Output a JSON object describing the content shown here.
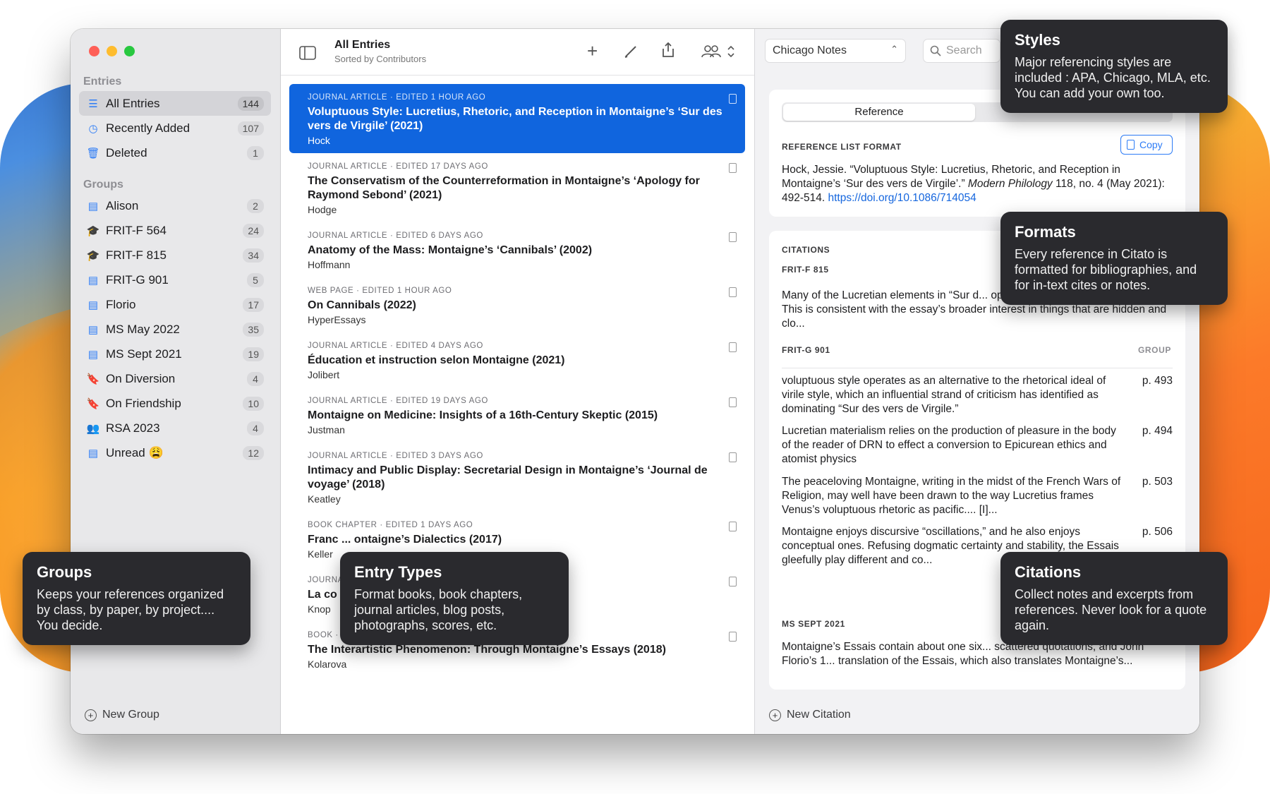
{
  "sidebar": {
    "entries_header": "Entries",
    "entries": [
      {
        "label": "All Entries",
        "count": "144",
        "icon": "list-icon"
      },
      {
        "label": "Recently Added",
        "count": "107",
        "icon": "clock-icon"
      },
      {
        "label": "Deleted",
        "count": "1",
        "icon": "trash-icon"
      }
    ],
    "groups_header": "Groups",
    "groups": [
      {
        "label": "Alison",
        "count": "2",
        "icon": "doc-icon"
      },
      {
        "label": "FRIT-F 564",
        "count": "24",
        "icon": "graduation-cap-icon"
      },
      {
        "label": "FRIT-F 815",
        "count": "34",
        "icon": "graduation-cap-icon"
      },
      {
        "label": "FRIT-G 901",
        "count": "5",
        "icon": "doc-icon"
      },
      {
        "label": "Florio",
        "count": "17",
        "icon": "doc-icon"
      },
      {
        "label": "MS May 2022",
        "count": "35",
        "icon": "doc-icon"
      },
      {
        "label": "MS Sept 2021",
        "count": "19",
        "icon": "doc-icon"
      },
      {
        "label": "On Diversion",
        "count": "4",
        "icon": "bookmark-icon"
      },
      {
        "label": "On Friendship",
        "count": "10",
        "icon": "bookmark-icon"
      },
      {
        "label": "RSA 2023",
        "count": "4",
        "icon": "speaker-icon"
      },
      {
        "label": "Unread 😩",
        "count": "12",
        "icon": "doc-icon"
      }
    ],
    "new_group": "New Group"
  },
  "toolbar": {
    "title": "All Entries",
    "subtitle": "Sorted by Contributors"
  },
  "entries": [
    {
      "meta": "Journal Article · Edited 1 hour ago",
      "title": "Voluptuous Style: Lucretius, Rhetoric, and Reception in Montaigne’s ‘Sur des vers de Virgile’ (2021)",
      "author": "Hock",
      "selected": true
    },
    {
      "meta": "Journal Article · Edited 17 days ago",
      "title": "The Conservatism of the Counterreformation in Montaigne’s ‘Apology for Raymond Sebond’ (2021)",
      "author": "Hodge"
    },
    {
      "meta": "Journal Article · Edited 6 days ago",
      "title": "Anatomy of the Mass: Montaigne’s ‘Cannibals’ (2002)",
      "author": "Hoffmann"
    },
    {
      "meta": "Web Page · Edited 1 hour ago",
      "title": "On Cannibals (2022)",
      "author": "HyperEssays"
    },
    {
      "meta": "Journal Article · Edited 4 days ago",
      "title": "Éducation et instruction selon Montaigne (2021)",
      "author": "Jolibert"
    },
    {
      "meta": "Journal Article · Edited 19 days ago",
      "title": "Montaigne on Medicine: Insights of a 16th-Century Skeptic (2015)",
      "author": "Justman"
    },
    {
      "meta": "Journal Article · Edited 3 days ago",
      "title": "Intimacy and Public Display: Secretarial Design in Montaigne’s ‘Journal de voyage’ (2018)",
      "author": "Keatley"
    },
    {
      "meta": "Book Chapter · Edited 1 days ago",
      "title": "Franc ... ontaigne’s Dialectics (2017)",
      "author": "Keller"
    },
    {
      "meta": "Journal Article",
      "title": "La co ... aigne, Essais, II, 25, « De ne contre",
      "author": "Knop"
    },
    {
      "meta": "Book · Edited 4 days ago",
      "title": "The Interartistic Phenomenon: Through Montaigne’s Essays (2018)",
      "author": "Kolarova"
    }
  ],
  "right": {
    "style_select": "Chicago Notes",
    "search_placeholder": "Search",
    "seg_reference": "Reference",
    "ref_list_label": "REFERENCE LIST FORMAT",
    "copy": "Copy",
    "ref_text": "Hock, Jessie. “Voluptuous Style: Lucretius, Rhetoric, and Reception in Montaigne’s ‘Sur des vers de Virgile’.” ",
    "ref_journal": "Modern Philology",
    "ref_tail": " 118, no. 4 (May 2021): 492-514. ",
    "ref_link": "https://doi.org/10.1086/714054",
    "citations_label": "CITATIONS",
    "group1": "FRIT-F 815",
    "group1_text": "Many of the Lucretian elements in “Sur d... operate as subtext, remaining veiled. This is consistent with the essay’s broader interest in things that are hidden and clo...",
    "group2": "FRIT-G 901",
    "group_col": "GROUP",
    "cites": [
      {
        "text": "voluptuous style operates as an alternative to the rhetorical ideal of virile style, which an influential strand of criticism has identified as dominating “Sur des vers de Virgile.”",
        "page": "p. 493"
      },
      {
        "text": "Lucretian materialism relies on the production of pleasure in the body of the reader of DRN to effect a conversion to Epicurean ethics and atomist physics",
        "page": "p. 494"
      },
      {
        "text": "The peaceloving Montaigne, writing in the midst of the French Wars of Religion, may well have been drawn to the way Lucretius frames Venus’s voluptuous rhetoric as pacific.... [I]...",
        "page": "p. 503"
      },
      {
        "text": "Montaigne enjoys discursive “oscillations,” and he also enjoys conceptual ones. Refusing dogmatic certainty and stability, the Essais gleefully play different and co...",
        "page": "p. 506"
      }
    ],
    "group3": "MS SEPT 2021",
    "group3_text": "Montaigne’s Essais contain about one six... scattered quotations, and John Florio’s 1... translation of the Essais, which also translates Montaigne’s...",
    "new_citation": "New Citation"
  },
  "tips": {
    "styles": {
      "title": "Styles",
      "body": "Major referencing styles are included : APA, Chicago, MLA, etc. You can add your own too."
    },
    "formats": {
      "title": "Formats",
      "body": "Every reference in Citato is formatted for bibliographies, and for in-text cites or notes."
    },
    "groups": {
      "title": "Groups",
      "body": "Keeps your references organized by class, by paper, by project.... You decide."
    },
    "types": {
      "title": "Entry Types",
      "body": "Format books, book chapters, journal articles, blog posts, photographs, scores, etc."
    },
    "citations": {
      "title": "Citations",
      "body": "Collect notes and excerpts from references. Never look for a quote again."
    }
  }
}
